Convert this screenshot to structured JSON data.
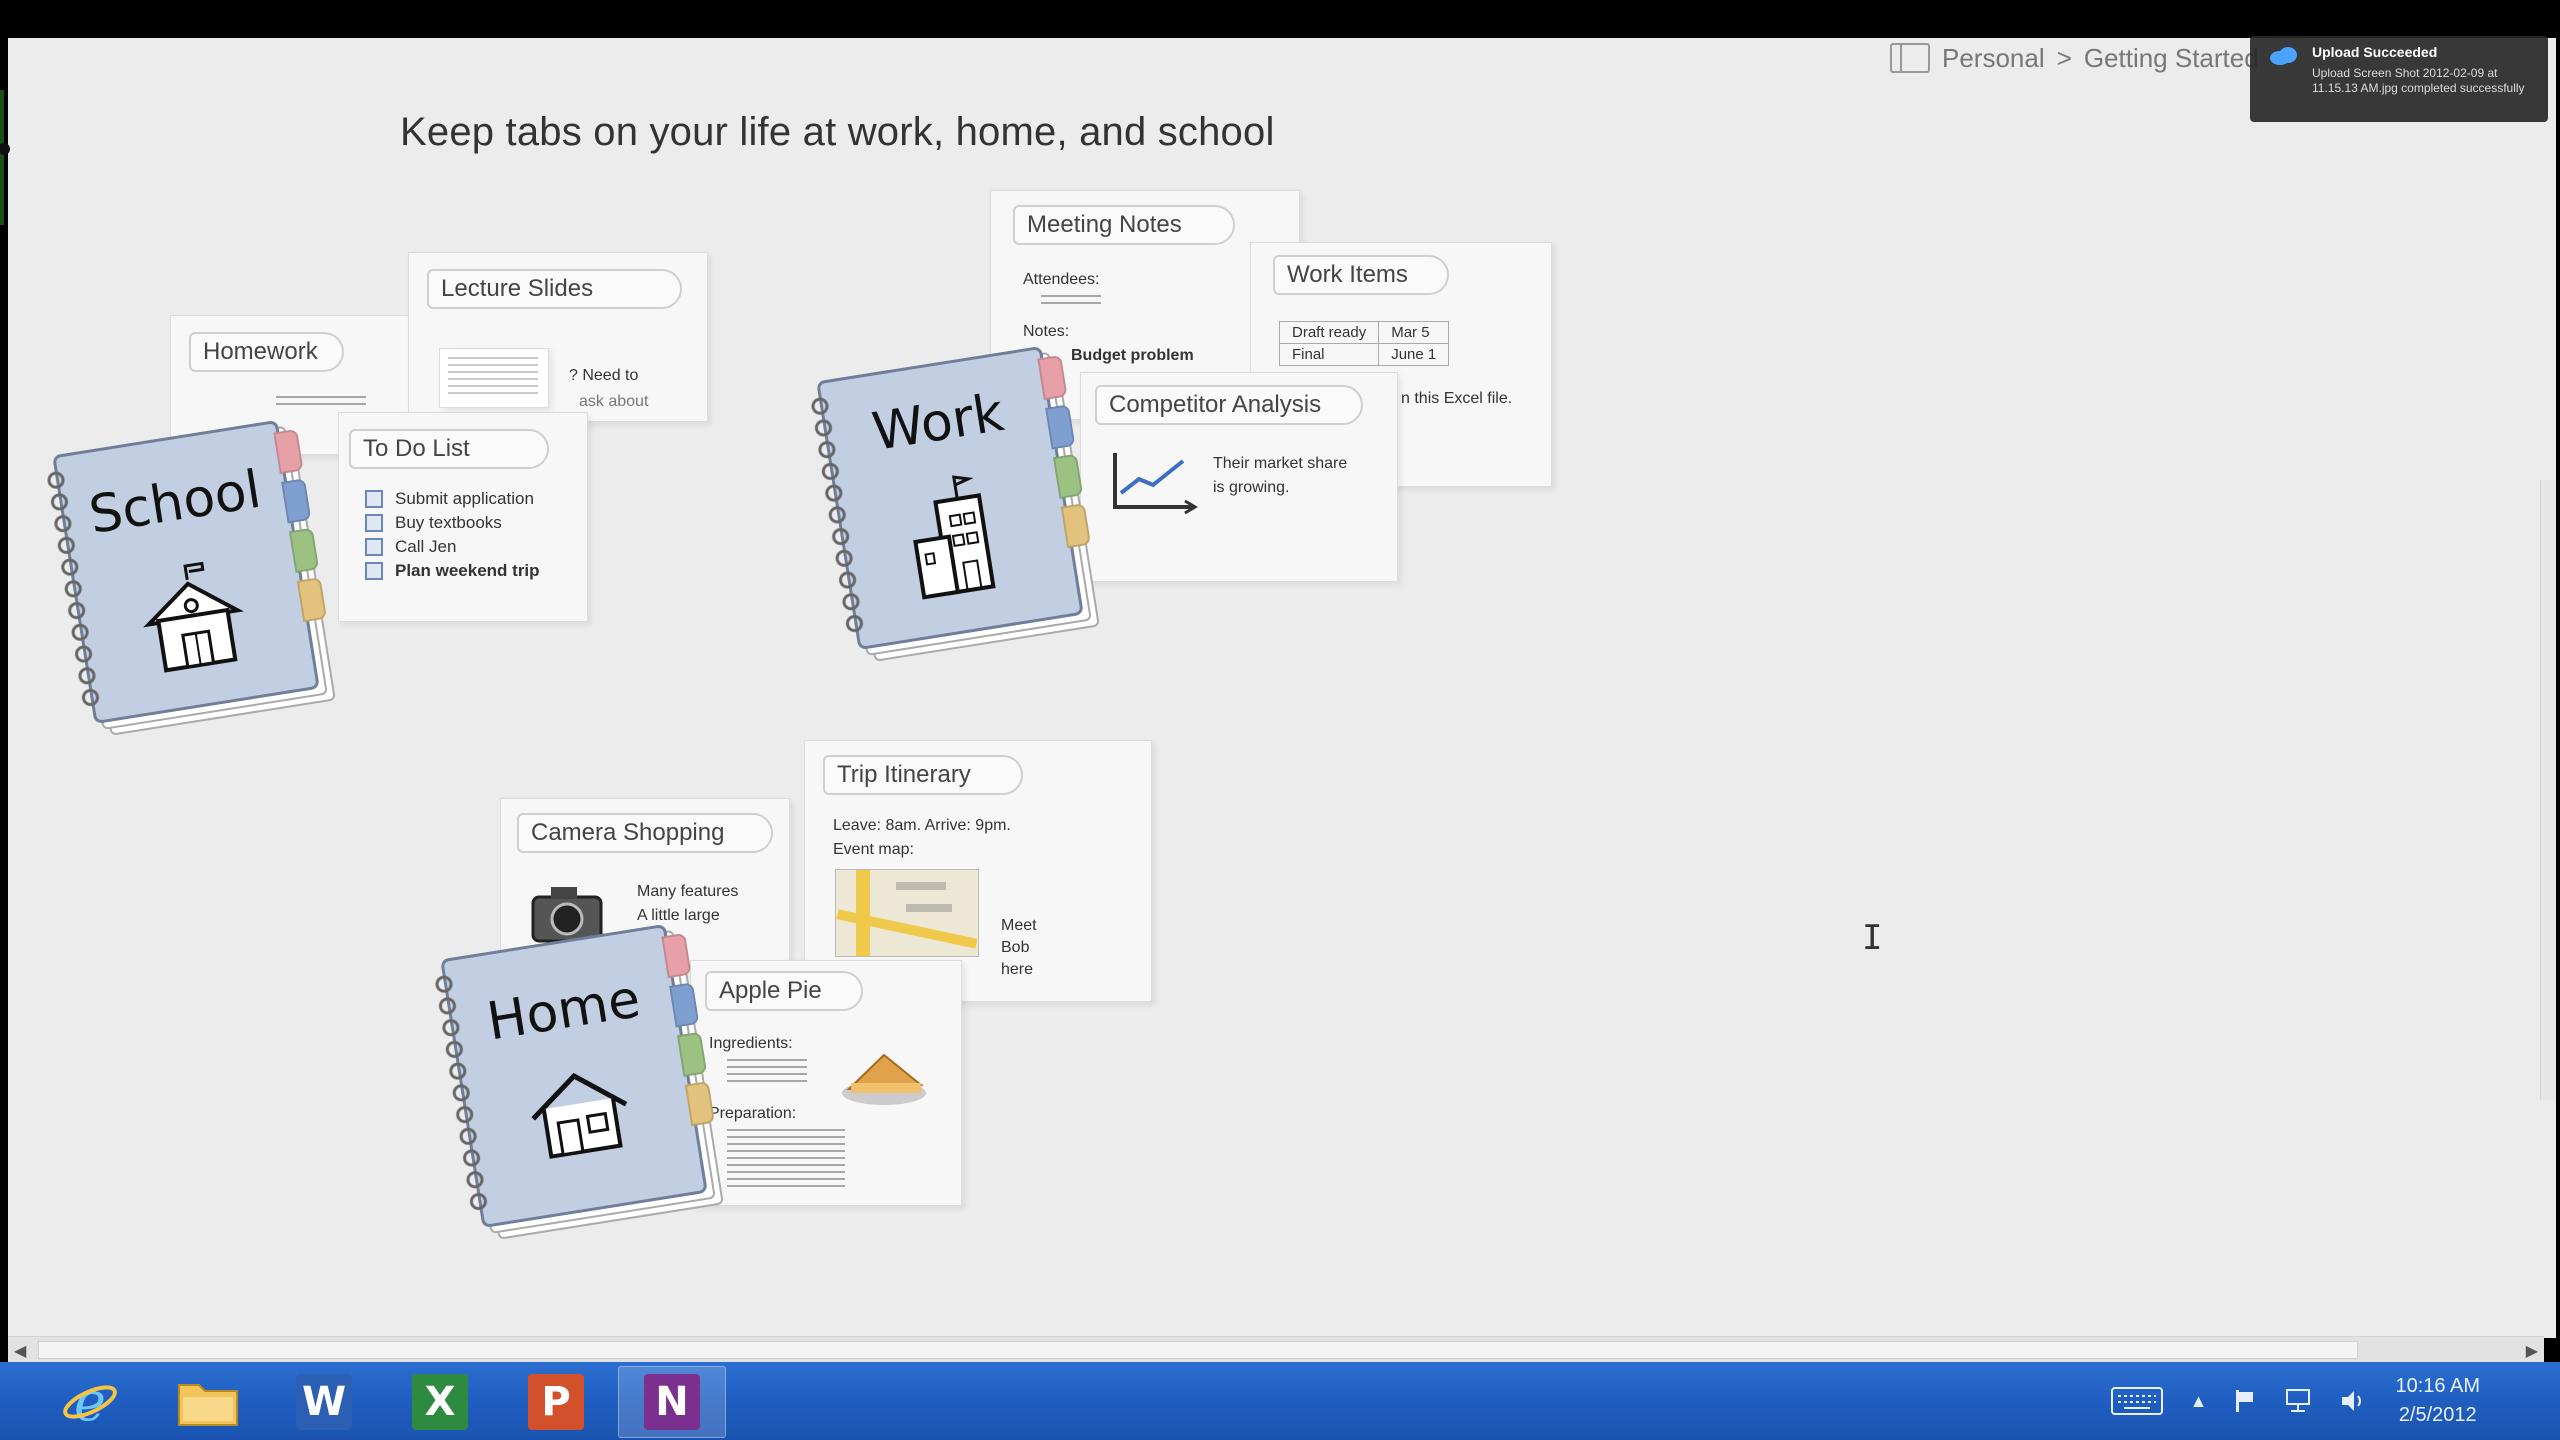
{
  "breadcrumb": {
    "notebook": "Personal",
    "separator": ">",
    "section": "Getting Started"
  },
  "page": {
    "title": "Keep tabs on your life at work, home, and school"
  },
  "school_group": {
    "notebook_title": "School",
    "homework": {
      "tab": "Homework"
    },
    "lecture_slides": {
      "tab": "Lecture Slides",
      "text1": "? Need to",
      "text2": "ask about"
    },
    "todo": {
      "tab": "To Do List",
      "items": [
        "Submit application",
        "Buy textbooks",
        "Call Jen",
        "Plan weekend trip"
      ]
    }
  },
  "work_group": {
    "notebook_title": "Work",
    "meeting_notes": {
      "tab": "Meeting Notes",
      "attendees": "Attendees:",
      "notes": "Notes:",
      "budget": "Budget problem"
    },
    "work_items": {
      "tab": "Work Items",
      "rows": [
        [
          "Draft ready",
          "Mar 5"
        ],
        [
          "Final",
          "June 1"
        ]
      ],
      "note": "n this Excel file."
    },
    "competitor": {
      "tab": "Competitor Analysis",
      "line1": "Their market share",
      "line2": "is growing."
    }
  },
  "home_group": {
    "notebook_title": "Home",
    "camera": {
      "tab": "Camera Shopping",
      "line1": "Many features",
      "line2": "A little large"
    },
    "trip": {
      "tab": "Trip Itinerary",
      "line1": "Leave: 8am. Arrive: 9pm.",
      "line2": "Event map:",
      "meet1": "Meet",
      "meet2": "Bob",
      "meet3": "here"
    },
    "apple_pie": {
      "tab": "Apple Pie",
      "ingredients": "Ingredients:",
      "preparation": "Preparation:"
    }
  },
  "toast": {
    "title": "Upload Succeeded",
    "body": "Upload Screen Shot 2012-02-09 at 11.15.13 AM.jpg completed successfully"
  },
  "taskbar": {
    "apps": [
      "Internet Explorer",
      "File Explorer",
      "Word",
      "Excel",
      "PowerPoint",
      "OneNote"
    ],
    "clock": {
      "time": "10:16 AM",
      "date": "2/5/2012"
    }
  },
  "colors": {
    "notebook_cover": "#c2cfe2",
    "taskbar": "#1f5ec0",
    "canvas": "#ececec"
  }
}
